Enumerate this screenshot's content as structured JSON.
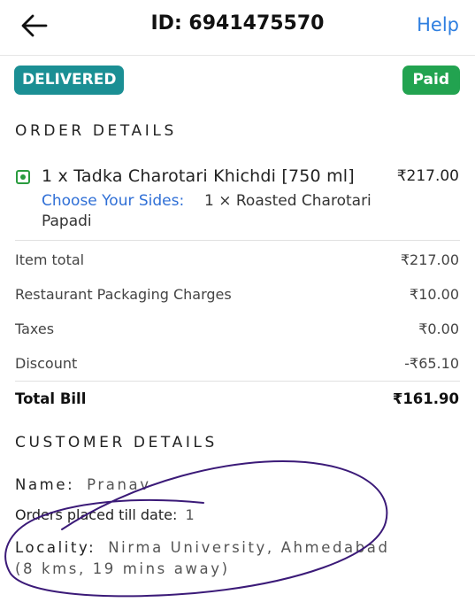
{
  "header": {
    "order_id": "ID: 6941475570",
    "help_label": "Help",
    "back_icon": "arrow-left-icon"
  },
  "status": {
    "delivered": "DELIVERED",
    "paid": "Paid",
    "delivered_color": "#1b8f94",
    "paid_color": "#22a350"
  },
  "order_details": {
    "title": "ORDER DETAILS",
    "item": {
      "name": "1 x Tadka Charotari Khichdi [750 ml]",
      "price": "₹217.00",
      "sides_label": "Choose Your Sides:",
      "sides_value_line1": "1 × Roasted Charotari",
      "sides_value_line2": "Papadi",
      "veg_icon": "veg-indicator-icon"
    },
    "bill": [
      {
        "label": "Item total",
        "value": "₹217.00"
      },
      {
        "label": "Restaurant Packaging Charges",
        "value": "₹10.00"
      },
      {
        "label": "Taxes",
        "value": "₹0.00"
      },
      {
        "label": "Discount",
        "value": "-₹65.10"
      }
    ],
    "total": {
      "label": "Total Bill",
      "value": "₹161.90"
    }
  },
  "customer_details": {
    "title": "CUSTOMER DETAILS",
    "name_label": "Name:",
    "name_value": "Pranav",
    "orders_label": "Orders placed till date:",
    "orders_value": "1",
    "locality_label": "Locality:",
    "locality_value_line1": "Nirma University, Ahmedabad",
    "locality_value_line2": "(8 kms, 19 mins away)"
  },
  "annotation_color": "#3b1a78"
}
